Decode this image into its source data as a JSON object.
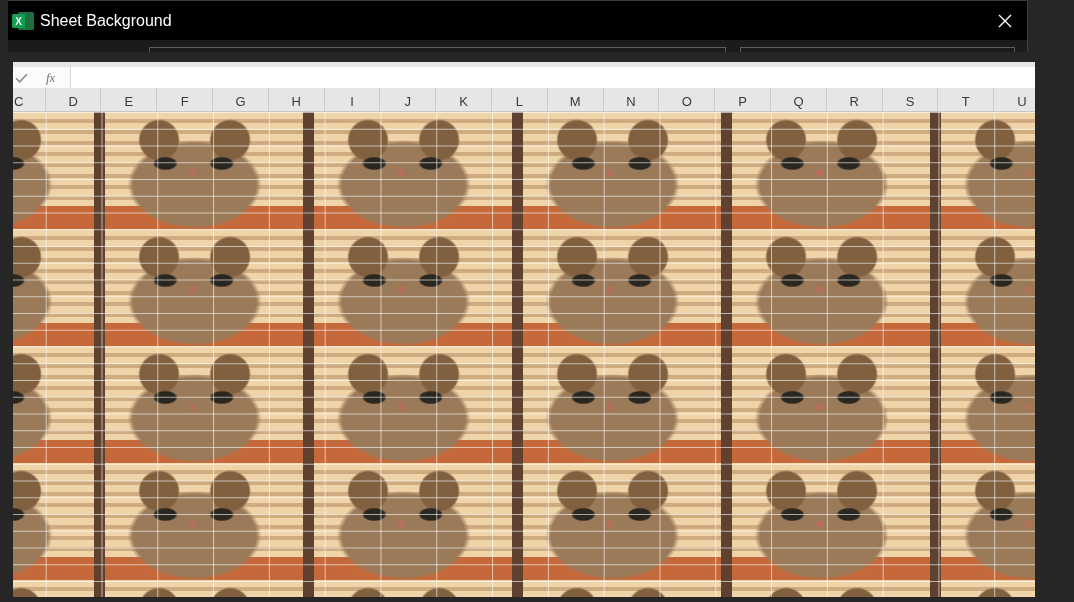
{
  "window": {
    "title": "Sheet Background",
    "icon_letter": "X"
  },
  "formula_bar": {
    "function_label": "fx"
  },
  "sheet": {
    "columns": [
      "C",
      "D",
      "E",
      "F",
      "G",
      "H",
      "I",
      "J",
      "K",
      "L",
      "M",
      "N",
      "O",
      "P",
      "Q",
      "R",
      "S",
      "T",
      "U"
    ]
  }
}
